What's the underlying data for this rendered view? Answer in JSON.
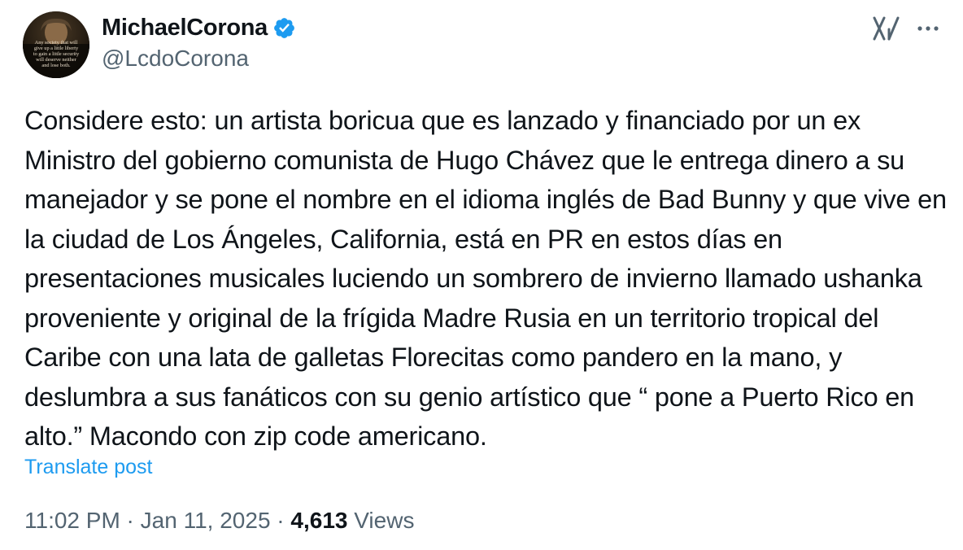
{
  "author": {
    "display_name": "MichaelCorona",
    "handle": "@LcdoCorona",
    "verified": true,
    "verified_color": "#1d9bf0",
    "avatar_quote": [
      "Any society that will",
      "give up a little liberty",
      "to gain a little security",
      "will deserve neither",
      "and lose both."
    ]
  },
  "actions": {
    "grok_icon": "grok-icon",
    "more_icon": "more-horizontal-icon"
  },
  "tweet": {
    "text": "Considere esto: un artista boricua que es lanzado y financiado por un ex Ministro del gobierno comunista de Hugo Chávez que le entrega dinero a su manejador y se pone el nombre en el idioma inglés de Bad Bunny y que vive en la ciudad de Los Ángeles, California, está en PR en estos días en presentaciones musicales luciendo un sombrero de invierno llamado ushanka proveniente y original de la frígida Madre Rusia en un territorio tropical del Caribe con una lata de galletas Florecitas como pandero en la mano, y deslumbra a sus fanáticos con su genio artístico que “ pone a Puerto Rico en alto.” Macondo con zip code americano.",
    "translate_label": "Translate post"
  },
  "meta": {
    "time": "11:02 PM",
    "separator": " · ",
    "date": "Jan 11, 2025",
    "views_count": "4,613",
    "views_label": "Views"
  },
  "colors": {
    "text_primary": "#0f1419",
    "text_secondary": "#536471",
    "link": "#1d9bf0"
  }
}
